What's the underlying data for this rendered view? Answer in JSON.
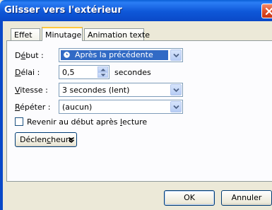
{
  "window": {
    "title": "Glisser vers l'extérieur"
  },
  "tabs": [
    {
      "label": "Effet"
    },
    {
      "label": "Minutage",
      "active": true
    },
    {
      "label": "Animation texte"
    }
  ],
  "form": {
    "start": {
      "label_pre": "D",
      "label_ul": "é",
      "label_post": "but :",
      "value": "Après la précédente",
      "icon": "clock-icon"
    },
    "delay": {
      "label_pre": "",
      "label_ul": "D",
      "label_post": "élai :",
      "value": "0,5",
      "unit": "secondes"
    },
    "speed": {
      "label_pre": "",
      "label_ul": "V",
      "label_post": "itesse :",
      "value": "3 secondes (lent)"
    },
    "repeat": {
      "label_pre": "",
      "label_ul": "R",
      "label_post": "épéter :",
      "value": "(aucun)"
    },
    "rewind": {
      "label_pre": "Revenir au début après ",
      "label_ul": "l",
      "label_post": "ecture",
      "checked": false
    },
    "triggers": {
      "label_pre": "Déclen",
      "label_ul": "c",
      "label_post": "heurs",
      "icon": "double-chevron-down-icon"
    }
  },
  "footer": {
    "ok_label": "OK",
    "cancel_label": "Annuler"
  },
  "colors": {
    "titlebar": "#0a49c8",
    "selection": "#316ac5",
    "face": "#ece9d8"
  }
}
